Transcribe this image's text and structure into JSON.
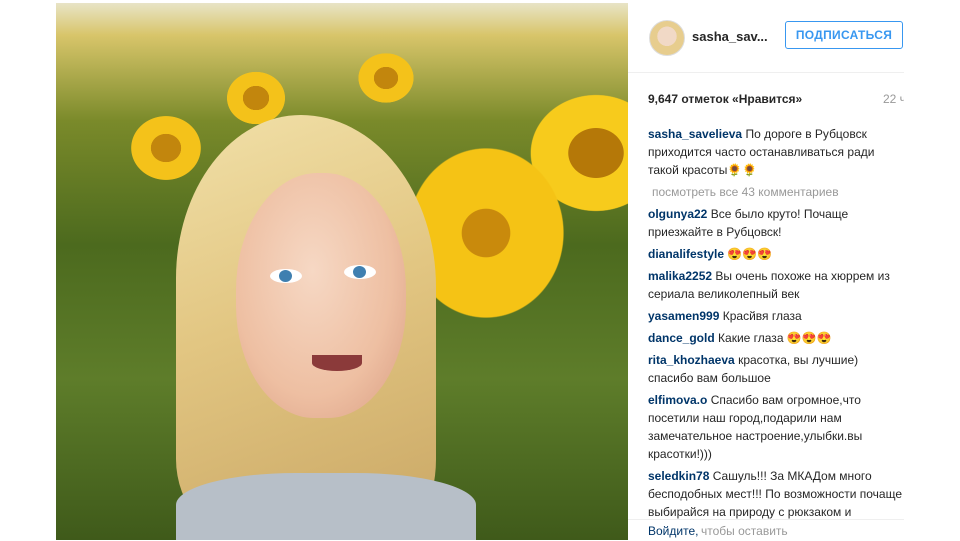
{
  "post": {
    "username": "sasha_sav...",
    "follow_label": "ПОДПИСАТЬСЯ",
    "likes": "9,647 отметок «Нравится»",
    "time": "22 ч"
  },
  "comments": [
    {
      "user": "sasha_savelieva",
      "text": "По дороге в Рубцовск приходится часто останавливаться ради такой красоты🌻🌻"
    },
    {
      "more": "посмотреть все 43 комментариев"
    },
    {
      "user": "olgunya22",
      "text": "Все было круто! Почаще приезжайте в Рубцовск!"
    },
    {
      "user": "dianalifestyle",
      "text": "😍😍😍"
    },
    {
      "user": "malika2252",
      "text": "Вы очень похоже на хюррем из сериала великолепный век"
    },
    {
      "user": "yasamen999",
      "text": "Красйвя глаза"
    },
    {
      "user": "dance_gold",
      "text": "Какие глаза 😍😍😍"
    },
    {
      "user": "rita_khozhaeva",
      "text": "красотка, вы лучшие) спасибо вам большое"
    },
    {
      "user": "elfimova.o",
      "text": "Спасибо вам огромное,что посетили наш город,подарили нам замечательное настроение,улыбки.вы красотки!)))"
    },
    {
      "user": "seledkin78",
      "text": "Сашуль!!! За МКАДом много бесподобных мест!!! По возможности почаще выбирайся на природу с рюкзаком и палаткой. И твоя лента"
    }
  ],
  "footer": {
    "login": "Войдите,",
    "rest": "чтобы оставить"
  },
  "colors": {
    "accent": "#3897f0",
    "username": "#003569",
    "muted": "#999999"
  }
}
